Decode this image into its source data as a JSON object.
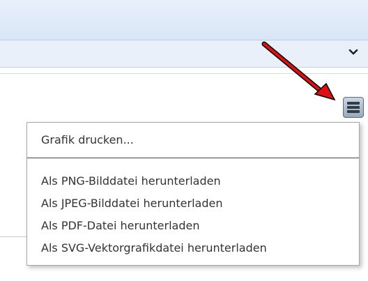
{
  "select_bar": {
    "chevron_icon": "chevron-down-icon"
  },
  "annotation": {
    "arrow_color": "#dd1111",
    "icon": "arrow-annotation-icon"
  },
  "menu_button": {
    "icon": "hamburger-menu-icon"
  },
  "export_menu": {
    "print_label": "Grafik drucken...",
    "items": [
      {
        "label": "Als PNG-Bilddatei herunterladen"
      },
      {
        "label": "Als JPEG-Bilddatei herunterladen"
      },
      {
        "label": "Als PDF-Datei herunterladen"
      },
      {
        "label": "Als SVG-Vektorgrafikdatei herunterladen"
      }
    ]
  }
}
